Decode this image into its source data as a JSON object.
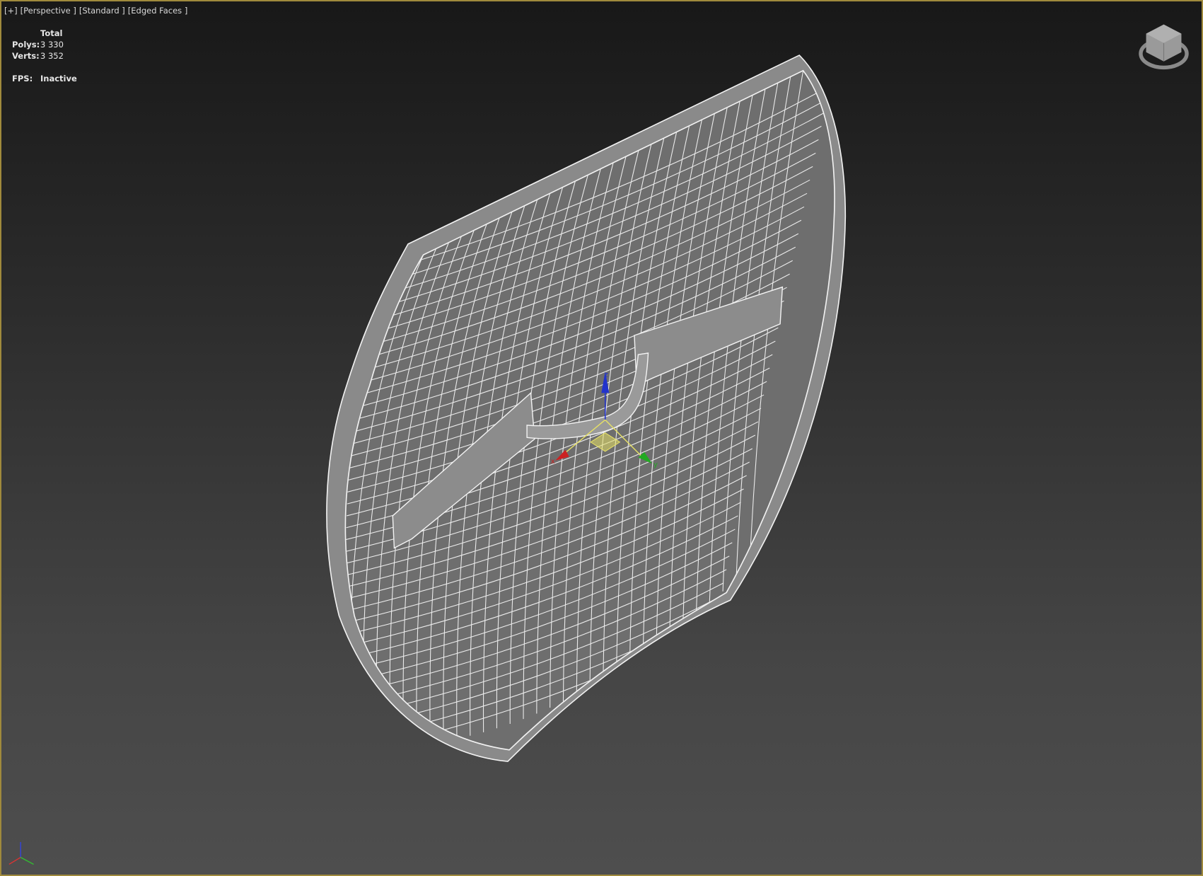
{
  "viewport": {
    "labels": [
      "[+]",
      "[Perspective ]",
      "[Standard ]",
      "[Edged Faces ]"
    ],
    "stats": {
      "header": "Total",
      "polys_label": "Polys:",
      "polys_value": "3 330",
      "verts_label": "Verts:",
      "verts_value": "3 352",
      "fps_label": "FPS:",
      "fps_value": "Inactive"
    },
    "gizmo_axes": {
      "x": "x",
      "y": "y",
      "z": "z"
    },
    "colors": {
      "border": "#a08a3c",
      "x_axis": "#cc2222",
      "y_axis": "#22aa22",
      "z_axis": "#2233cc",
      "plane": "#e6e066"
    }
  }
}
